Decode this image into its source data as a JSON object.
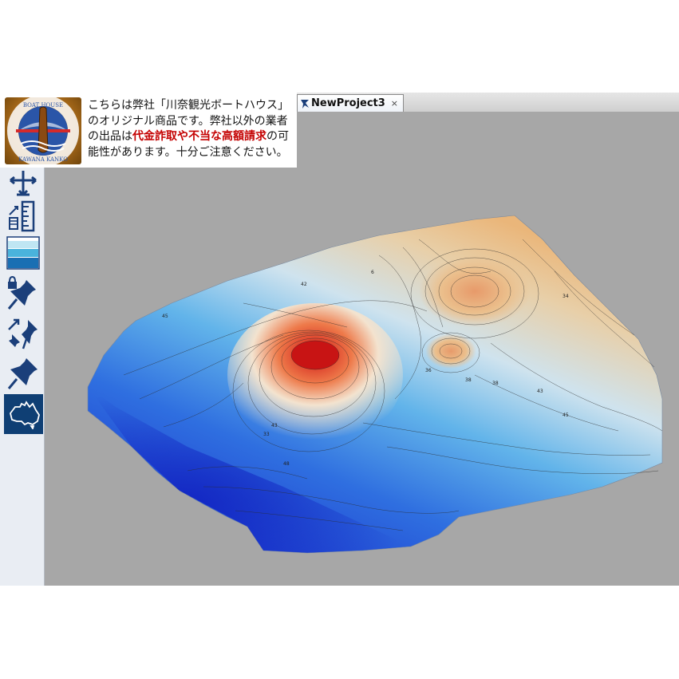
{
  "tab": {
    "title": "NewProject3",
    "close_symbol": "×"
  },
  "notice": {
    "logo": {
      "icon": "boat-house-logo",
      "text_top": "BOAT HOUSE",
      "text_bottom": "KAWANA KANKO"
    },
    "line_part1": "こちらは弊社「川奈観光ボートハウス」のオリジナル商品です。弊社以外の業者の出品は",
    "highlight": "代金詐取や不当な高額請求",
    "line_part2": "の可能性があります。十分ご注意ください。"
  },
  "toolbar": {
    "tools": [
      {
        "name": "move-vertical-icon",
        "active": false
      },
      {
        "name": "scale-ruler-icon",
        "active": false
      },
      {
        "name": "water-layers-icon",
        "active": false
      },
      {
        "name": "locked-pin-icon",
        "active": false
      },
      {
        "name": "resize-pins-icon",
        "active": false
      },
      {
        "name": "pin-icon",
        "active": false
      },
      {
        "name": "australia-map-icon",
        "active": true
      }
    ]
  },
  "map": {
    "contour_labels": [
      "48",
      "45",
      "43",
      "38",
      "36",
      "33",
      "38",
      "34",
      "45",
      "6",
      "43",
      "42"
    ],
    "colors": {
      "deep": "#1a2fd0",
      "mid": "#4aa8e6",
      "shallow": "#e8f1f6",
      "warm": "#e8b77e",
      "peak": "#d81e1e",
      "background": "#a7a7a7"
    }
  }
}
